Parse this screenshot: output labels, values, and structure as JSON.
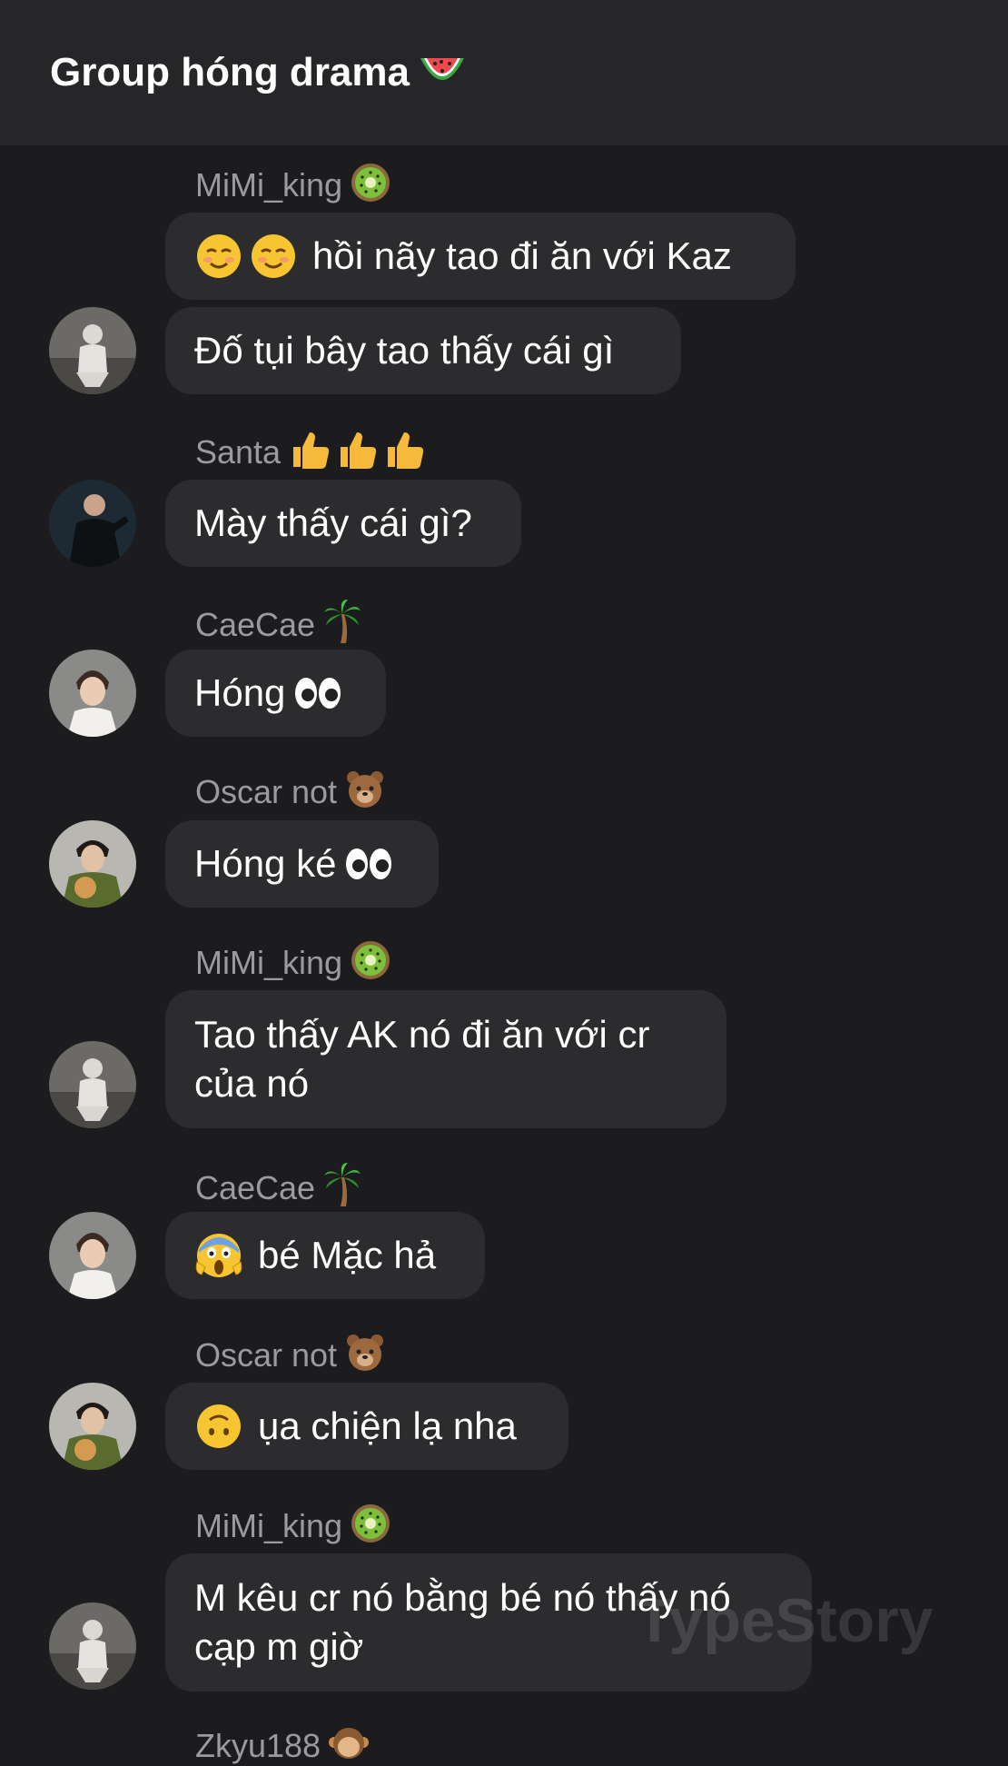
{
  "header": {
    "title": "Group hóng drama",
    "title_icon": "watermelon-icon"
  },
  "messages": [
    {
      "sender": "MiMi_king",
      "sender_icon": "kiwi-icon",
      "lines": [
        {
          "icons": [
            "smiling-blush-icon",
            "smiling-blush-icon"
          ],
          "text": "hồi nãy tao đi ăn với Kaz"
        },
        {
          "icons": [],
          "text": "Đố tụi bây tao thấy cái gì"
        }
      ]
    },
    {
      "sender": "Santa",
      "sender_icon": "thumbs-up-icon x3",
      "lines": [
        {
          "icons": [],
          "text": "Mày thấy cái gì?"
        }
      ]
    },
    {
      "sender": "CaeCae",
      "sender_icon": "palm-tree-icon",
      "lines": [
        {
          "icons": [],
          "text": "Hóng",
          "trailing_icon": "eyes-icon"
        }
      ]
    },
    {
      "sender": "Oscar not",
      "sender_icon": "bear-icon",
      "lines": [
        {
          "icons": [],
          "text": "Hóng ké",
          "trailing_icon": "eyes-icon"
        }
      ]
    },
    {
      "sender": "MiMi_king",
      "sender_icon": "kiwi-icon",
      "lines": [
        {
          "icons": [],
          "text": "Tao thấy AK nó đi ăn với cr\ncủa nó"
        }
      ]
    },
    {
      "sender": "CaeCae",
      "sender_icon": "palm-tree-icon",
      "lines": [
        {
          "icons": [
            "screaming-face-icon"
          ],
          "text": "bé Mặc hả"
        }
      ]
    },
    {
      "sender": "Oscar not",
      "sender_icon": "bear-icon",
      "lines": [
        {
          "icons": [
            "upside-down-face-icon"
          ],
          "text": "ụa chiện lạ nha"
        }
      ]
    },
    {
      "sender": "MiMi_king",
      "sender_icon": "kiwi-icon",
      "lines": [
        {
          "icons": [],
          "text": "M kêu cr nó bằng bé nó thấy nó\ncạp m giờ"
        }
      ]
    },
    {
      "sender": "Zkyu188",
      "sender_icon": "monkey-icon",
      "lines": []
    }
  ],
  "watermark": "TypeStory"
}
